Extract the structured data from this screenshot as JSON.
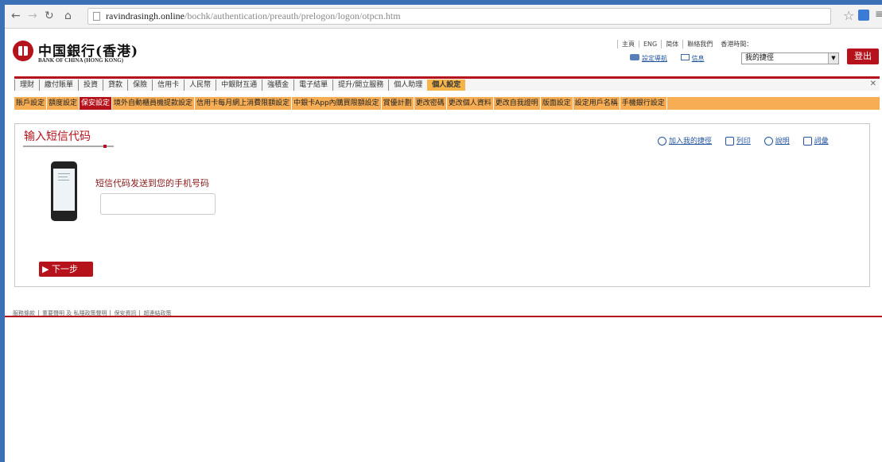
{
  "browser": {
    "url_host": "ravindrasingh.online",
    "url_path": "/bochk/authentication/preauth/prelogon/logon/otpcn.htm"
  },
  "bank": {
    "name_cn": "中国銀行(香港)",
    "name_en": "BANK OF CHINA (HONG KONG)"
  },
  "header": {
    "top_links": [
      "主頁",
      "ENG",
      "简体",
      "聯絡我們",
      "香港時間："
    ],
    "settings_link": "設定導航",
    "messages_link": "信息",
    "quick_select": "我的捷徑",
    "logout": "登出"
  },
  "main_nav": [
    "理財",
    "繳付賬單",
    "投資",
    "貸款",
    "保險",
    "信用卡",
    "人民幣",
    "中銀財互通",
    "強積金",
    "電子結單",
    "提升/開立服務",
    "個人助理",
    "個人設定"
  ],
  "sub_nav": [
    "賬戶設定",
    "額度設定",
    "保安設定",
    "境外自動櫃員機提款設定",
    "信用卡每月網上消費限額設定",
    "中銀卡App內購買限額設定",
    "賞優計劃",
    "更改密碼",
    "更改個人資料",
    "更改自我證明",
    "版面設定",
    "設定用戶名稱",
    "手機銀行設定"
  ],
  "content": {
    "title": "输入短信代码",
    "tools": [
      "加入我的捷徑",
      "列印",
      "說明",
      "詞彙"
    ],
    "prompt": "短信代码发送到您的手机号码",
    "otp_value": "",
    "next": "下一步"
  },
  "footer": [
    "服務條款",
    "重要聲明 及 私隱政策聲明",
    "保安資訊",
    "超連結政策"
  ],
  "colors": {
    "brand": "#b5121b",
    "accent": "#f6ad54"
  }
}
